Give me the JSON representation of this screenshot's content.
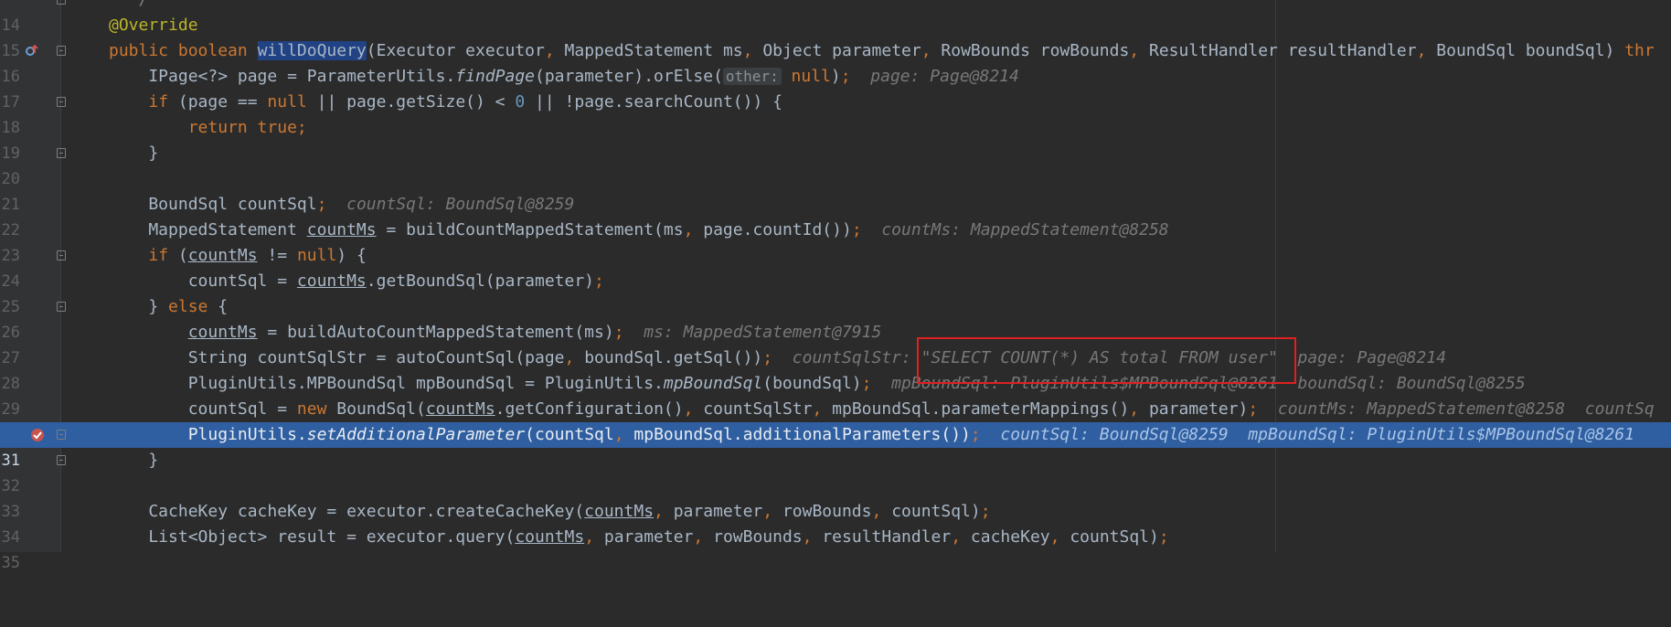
{
  "lines": [
    {
      "num": "14",
      "code": "  */"
    },
    {
      "num": "15",
      "code": "@Override"
    },
    {
      "num": "16",
      "code": "public boolean willDoQuery(Executor executor, MappedStatement ms, Object parameter, RowBounds rowBounds, ResultHandler resultHandler, BoundSql boundSql) thr"
    },
    {
      "num": "17",
      "code": "    IPage<?> page = ParameterUtils.findPage(parameter).orElse( other: null);",
      "hint": "page: Page@8214"
    },
    {
      "num": "18",
      "code": "    if (page == null || page.getSize() < 0 || !page.searchCount()) {"
    },
    {
      "num": "19",
      "code": "        return true;"
    },
    {
      "num": "20",
      "code": "    }"
    },
    {
      "num": "21",
      "code": ""
    },
    {
      "num": "22",
      "code": "    BoundSql countSql;",
      "hint": "countSql: BoundSql@8259"
    },
    {
      "num": "23",
      "code": "    MappedStatement countMs = buildCountMappedStatement(ms, page.countId());",
      "hint": "countMs: MappedStatement@8258"
    },
    {
      "num": "24",
      "code": "    if (countMs != null) {"
    },
    {
      "num": "25",
      "code": "        countSql = countMs.getBoundSql(parameter);"
    },
    {
      "num": "26",
      "code": "    } else {"
    },
    {
      "num": "27",
      "code": "        countMs = buildAutoCountMappedStatement(ms);",
      "hint": "ms: MappedStatement@7915"
    },
    {
      "num": "28",
      "code": "        String countSqlStr = autoCountSql(page, boundSql.getSql());",
      "hint": "countSqlStr: \"SELECT COUNT(*) AS total FROM user\"  page: Page@8214"
    },
    {
      "num": "29",
      "code": "        PluginUtils.MPBoundSql mpBoundSql = PluginUtils.mpBoundSql(boundSql);",
      "hint": "mpBoundSql: PluginUtils$MPBoundSql@8261  boundSql: BoundSql@8255"
    },
    {
      "num": "30",
      "code": "        countSql = new BoundSql(countMs.getConfiguration(), countSqlStr, mpBoundSql.parameterMappings(), parameter);",
      "hint": "countMs: MappedStatement@8258  countSq"
    },
    {
      "num": "31",
      "code": "        PluginUtils.setAdditionalParameter(countSql, mpBoundSql.additionalParameters());",
      "hint": "countSql: BoundSql@8259  mpBoundSql: PluginUtils$MPBoundSql@8261"
    },
    {
      "num": "32",
      "code": "    }"
    },
    {
      "num": "33",
      "code": ""
    },
    {
      "num": "34",
      "code": "    CacheKey cacheKey = executor.createCacheKey(countMs, parameter, rowBounds, countSql);"
    },
    {
      "num": "35",
      "code": "    List<Object> result = executor.query(countMs, parameter, rowBounds, resultHandler, cacheKey, countSql);"
    }
  ],
  "current_line": "31",
  "inlay_param_hint": "other:",
  "highlighted_hint": "\"SELECT COUNT(*) AS total FROM user\"",
  "icons": [
    "override-icon",
    "breakpoint-icon",
    "fold-icon"
  ],
  "colors": {
    "background": "#2b2b2b",
    "keyword": "#cc7832",
    "annotation": "#bbb529",
    "number": "#6897bb",
    "execution_line": "#2f5fa0",
    "highlight_box": "#e02020"
  }
}
